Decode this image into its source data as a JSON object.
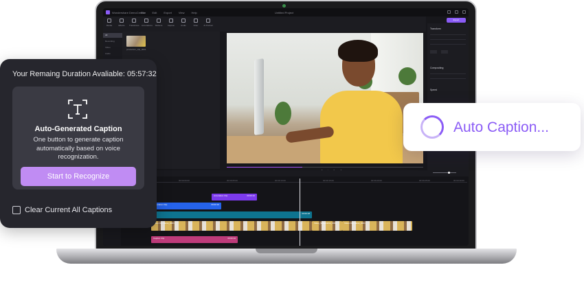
{
  "editor": {
    "app_name": "Wondershare DemoCreator",
    "menus": [
      "File",
      "Edit",
      "Export",
      "View",
      "Help"
    ],
    "document_title": "Untitled Project",
    "export_label": "Export",
    "tools": [
      "Media",
      "Effects",
      "Transitions",
      "Annotations",
      "Stickers",
      "Caption",
      "Audio",
      "Filter",
      "AI Portrait"
    ],
    "media_categories": [
      "All",
      "Recording",
      "Video",
      "Audio",
      "Image",
      "Others"
    ],
    "media_item_name": "production_clip_0001",
    "properties_heading": "Transform",
    "compositing_heading": "Compositing",
    "speed_heading": "Speed",
    "timecodes": [
      "00:00:00:00",
      "00:00:05:00",
      "00:00:10:00",
      "00:00:15:00",
      "00:00:20:00",
      "00:00:25:00",
      "00:00:30:00"
    ],
    "clips": {
      "annotation": {
        "label": "Annotation Clip",
        "duration": "00:00:10"
      },
      "caption_blue": {
        "label": "Annotation Clip",
        "duration": "00:00:10"
      },
      "teal_duration": "00:00:18",
      "video_a": {
        "label": "Video Clip Name_0001"
      },
      "video_b": {
        "label": "Video_Screenshot_0001"
      },
      "video_c": {
        "label": "Video Clip Name_0001"
      },
      "caption": {
        "label": "Caption Clip",
        "duration": "00:00:10"
      }
    }
  },
  "caption_panel": {
    "remaining_label": "Your Remaing Duration Avaliable: 05:57:32",
    "title": "Auto-Generated Caption",
    "description": "One button to generate caption automatically based on voice recognization.",
    "button_label": "Start to Recognize",
    "clear_label": "Clear Current All Captions"
  },
  "auto_caption": {
    "status_text": "Auto Caption..."
  },
  "colors": {
    "accent": "#8b5cf6",
    "button": "#c08cf3",
    "panel": "#26262d"
  }
}
